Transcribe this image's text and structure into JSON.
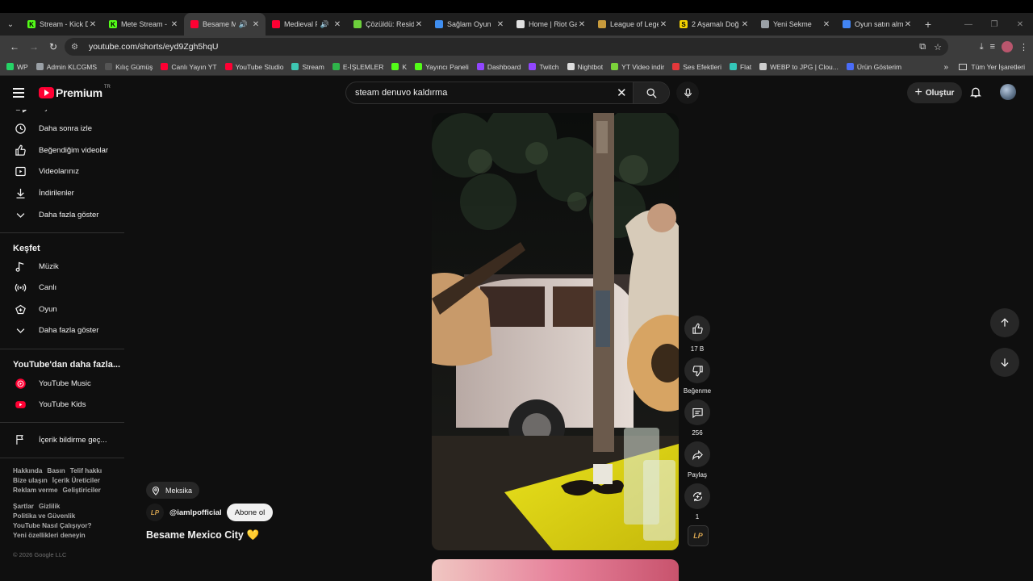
{
  "browser": {
    "tabs": [
      {
        "title": "Stream - Kick D",
        "favicon_color": "#53fc18",
        "favicon_letter": "K",
        "active": false,
        "sound": false
      },
      {
        "title": "Mete Stream -",
        "favicon_color": "#53fc18",
        "favicon_letter": "K",
        "active": false,
        "sound": false
      },
      {
        "title": "Besame M",
        "favicon_color": "#ff0033",
        "favicon_letter": "",
        "active": true,
        "sound": true
      },
      {
        "title": "Medieval F",
        "favicon_color": "#ff0033",
        "favicon_letter": "",
        "active": false,
        "sound": true
      },
      {
        "title": "Çözüldü: Resid",
        "favicon_color": "#6ccf3b",
        "favicon_letter": "",
        "active": false,
        "sound": false
      },
      {
        "title": "Sağlam Oyun",
        "favicon_color": "#3f8ef0",
        "favicon_letter": "",
        "active": false,
        "sound": false
      },
      {
        "title": "Home | Riot Ga",
        "favicon_color": "#e0e0e0",
        "favicon_letter": "",
        "active": false,
        "sound": false
      },
      {
        "title": "League of Lege",
        "favicon_color": "#c89b3c",
        "favicon_letter": "",
        "active": false,
        "sound": false
      },
      {
        "title": "2 Aşamalı Doğ",
        "favicon_color": "#f5d300",
        "favicon_letter": "S",
        "active": false,
        "sound": false
      },
      {
        "title": "Yeni Sekme",
        "favicon_color": "#9aa0a6",
        "favicon_letter": "",
        "active": false,
        "sound": false
      },
      {
        "title": "Oyun satın alm",
        "favicon_color": "#4285f4",
        "favicon_letter": "",
        "active": false,
        "sound": false
      }
    ],
    "url": "youtube.com/shorts/eyd9Zgh5hqU",
    "bookmarks": [
      {
        "label": "WP",
        "color": "#25d366"
      },
      {
        "label": "Admin KLCGMS",
        "color": "#9aa0a6"
      },
      {
        "label": "Kılıç Gümüş",
        "color": "#555555"
      },
      {
        "label": "Canlı Yayın YT",
        "color": "#ff0033"
      },
      {
        "label": "YouTube Studio",
        "color": "#ff0033"
      },
      {
        "label": "Stream",
        "color": "#3ec6b2"
      },
      {
        "label": "E-İŞLEMLER",
        "color": "#2fb44a"
      },
      {
        "label": "K",
        "color": "#53fc18"
      },
      {
        "label": "Yayıncı Paneli",
        "color": "#53fc18"
      },
      {
        "label": "Dashboard",
        "color": "#9146ff"
      },
      {
        "label": "Twitch",
        "color": "#9146ff"
      },
      {
        "label": "Nightbot",
        "color": "#dddddd"
      },
      {
        "label": "YT Video indir",
        "color": "#7bd23a"
      },
      {
        "label": "Ses Efektleri",
        "color": "#e5383b"
      },
      {
        "label": "Flat",
        "color": "#34c5b8"
      },
      {
        "label": "WEBP to JPG | Clou...",
        "color": "#cfcfcf"
      },
      {
        "label": "Ürün Gösterim",
        "color": "#4a6cf7"
      }
    ],
    "all_bookmarks": "Tüm Yer İşaretleri"
  },
  "header": {
    "logo_text": "Premium",
    "region": "TR",
    "search_value": "steam denuvo kaldırma",
    "create_label": "Oluştur"
  },
  "sidebar": {
    "top_items": [
      {
        "label": "Oynatma listeleri",
        "icon": "playlist-icon"
      },
      {
        "label": "Daha sonra izle",
        "icon": "clock-icon"
      },
      {
        "label": "Beğendiğim videolar",
        "icon": "thumb-up-icon"
      },
      {
        "label": "Videolarınız",
        "icon": "video-icon"
      },
      {
        "label": "İndirilenler",
        "icon": "download-icon"
      },
      {
        "label": "Daha fazla göster",
        "icon": "chevron-down-icon"
      }
    ],
    "explore_title": "Keşfet",
    "explore_items": [
      {
        "label": "Müzik",
        "icon": "music-icon"
      },
      {
        "label": "Canlı",
        "icon": "live-icon"
      },
      {
        "label": "Oyun",
        "icon": "gaming-icon"
      },
      {
        "label": "Daha fazla göster",
        "icon": "chevron-down-icon"
      }
    ],
    "more_title": "YouTube'dan daha fazla...",
    "more_items": [
      {
        "label": "YouTube Music",
        "icon": "yt-music-icon"
      },
      {
        "label": "YouTube Kids",
        "icon": "yt-kids-icon"
      }
    ],
    "report_label": "İçerik bildirme geç...",
    "footer_lines": [
      [
        "Hakkında",
        "Basın",
        "Telif hakkı"
      ],
      [
        "Bize ulaşın",
        "İçerik Üreticiler"
      ],
      [
        "Reklam verme",
        "Geliştiriciler"
      ]
    ],
    "footer_lines2": [
      [
        "Şartlar",
        "Gizlilik"
      ],
      [
        "Politika ve Güvenlik"
      ],
      [
        "YouTube Nasıl Çalışıyor?"
      ],
      [
        "Yeni özellikleri deneyin"
      ]
    ],
    "copyright": "© 2026 Google LLC"
  },
  "short": {
    "location": "Meksika",
    "channel": "@iamlpofficial",
    "channel_avatar_text": "LP",
    "subscribe_label": "Abone ol",
    "title": "Besame Mexico City",
    "title_emoji": "💛",
    "likes": "17 B",
    "dislike_label": "Beğenme",
    "comments": "256",
    "share_label": "Paylaş",
    "remix_count": "1"
  }
}
